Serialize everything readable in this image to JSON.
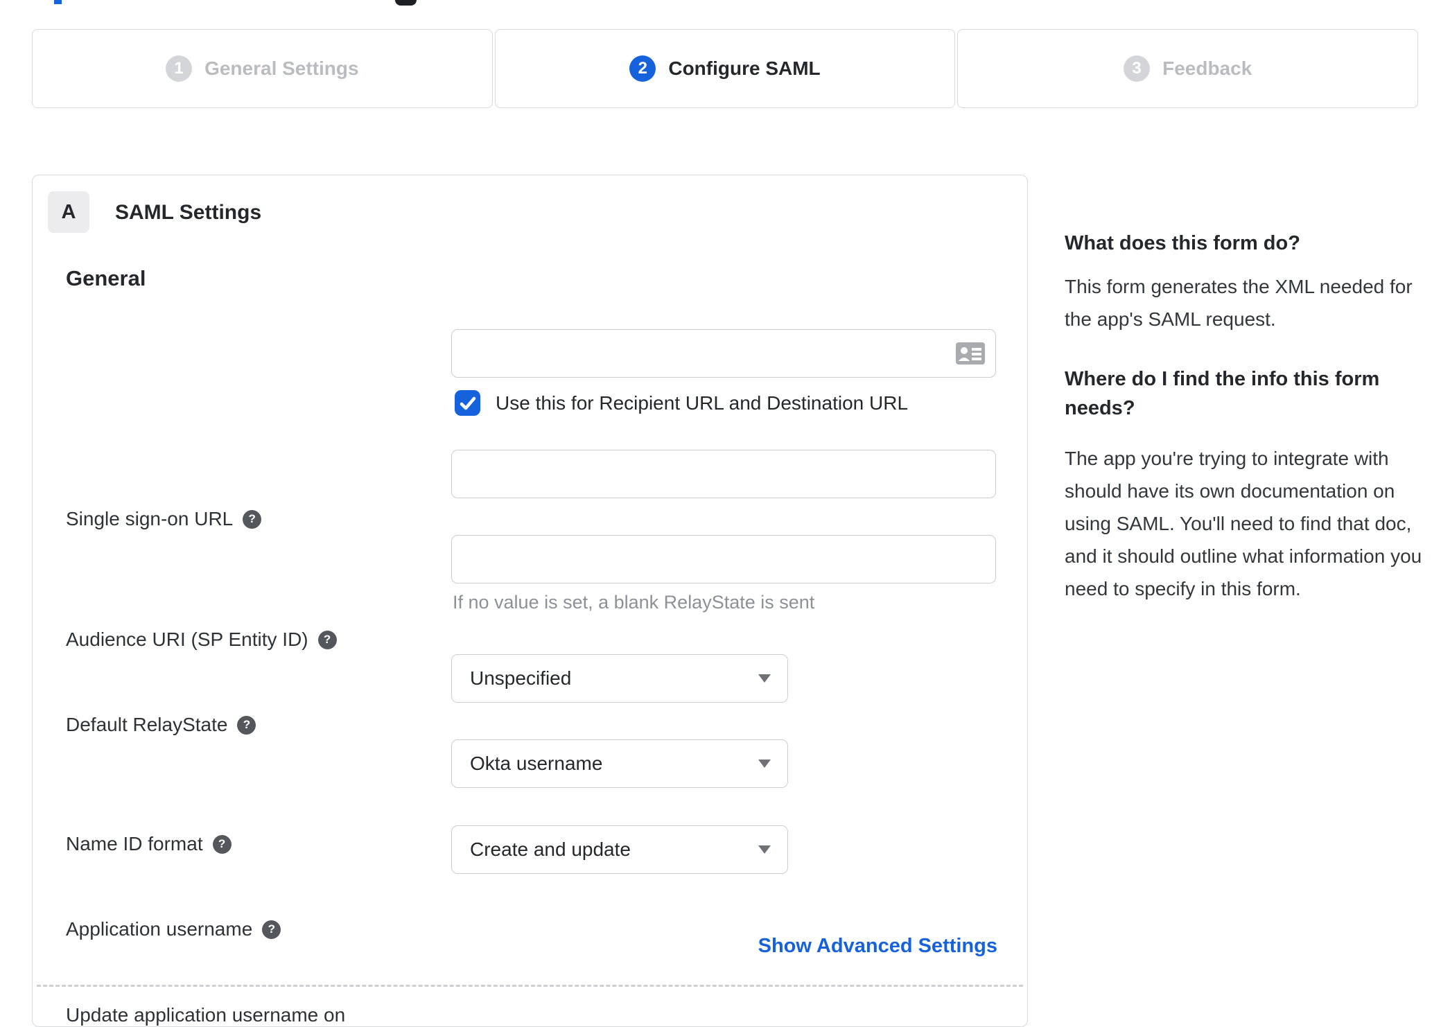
{
  "colors": {
    "accent": "#1662dd",
    "inactive_gray": "#b9bcc1",
    "border": "#d8d9dd"
  },
  "stepper": {
    "steps": [
      {
        "number": "1",
        "label": "General Settings"
      },
      {
        "number": "2",
        "label": "Configure SAML"
      },
      {
        "number": "3",
        "label": "Feedback"
      }
    ],
    "active_step": "2"
  },
  "panel": {
    "badge": "A",
    "title": "SAML Settings",
    "section": "General",
    "sso": {
      "label": "Single sign-on URL",
      "value": "",
      "checkbox_label": "Use this for Recipient URL and Destination URL",
      "checkbox_checked": true
    },
    "audience": {
      "label": "Audience URI (SP Entity ID)",
      "value": ""
    },
    "relay": {
      "label": "Default RelayState",
      "value": "",
      "hint": "If no value is set, a blank RelayState is sent"
    },
    "nameid": {
      "label": "Name ID format",
      "value": "Unspecified"
    },
    "appuser": {
      "label": "Application username",
      "value": "Okta username"
    },
    "updateuser": {
      "label": "Update application username on",
      "value": "Create and update"
    },
    "advanced_link": "Show Advanced Settings"
  },
  "sidebar": {
    "q1": "What does this form do?",
    "a1": "This form generates the XML needed for the app's SAML request.",
    "q2": "Where do I find the info this form needs?",
    "a2": "The app you're trying to integrate with should have its own documentation on using SAML. You'll need to find that doc, and it should outline what information you need to specify in this form."
  }
}
